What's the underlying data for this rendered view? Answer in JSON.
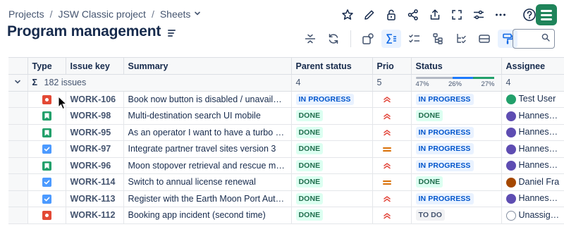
{
  "breadcrumb": {
    "projects": "Projects",
    "project": "JSW Classic project",
    "sheets": "Sheets"
  },
  "page": {
    "title": "Program management"
  },
  "table": {
    "columns": {
      "type": "Type",
      "key": "Issue key",
      "summary": "Summary",
      "parent_status": "Parent status",
      "prio": "Prio",
      "status": "Status",
      "assignee": "Assignee"
    },
    "summary_row": {
      "sigma": "Σ",
      "issues": "182 issues",
      "parent_status": "4",
      "prio": "5",
      "assignee": "4",
      "status_progress": {
        "todo": {
          "percent": 47,
          "label": "47%"
        },
        "in_progress": {
          "percent": 26,
          "label": "26%"
        },
        "done": {
          "percent": 27,
          "label": "27%"
        }
      }
    },
    "rows": [
      {
        "type": "bug",
        "key": "WORK-106",
        "summary": "Book now button is disabled / unavailable",
        "parent_status": "IN PROGRESS",
        "priority": "high",
        "status": "IN PROGRESS",
        "assignee": "Test User"
      },
      {
        "type": "story",
        "key": "WORK-98",
        "summary": "Multi-destination search UI mobile",
        "parent_status": "DONE",
        "priority": "high",
        "status": "DONE",
        "assignee": "Hannes Ob"
      },
      {
        "type": "story",
        "key": "WORK-95",
        "summary": "As an operator I want to have a turbo butt...",
        "parent_status": "DONE",
        "priority": "high",
        "status": "IN PROGRESS",
        "assignee": "Hannes Ob"
      },
      {
        "type": "task",
        "key": "WORK-97",
        "summary": "Integrate partner travel sites version 3",
        "parent_status": "DONE",
        "priority": "medium",
        "status": "IN PROGRESS",
        "assignee": "Hannes Ob"
      },
      {
        "type": "story",
        "key": "WORK-96",
        "summary": "Moon stopover retrieval and rescue missi...",
        "parent_status": "DONE",
        "priority": "high",
        "status": "IN PROGRESS",
        "assignee": "Hannes Ob"
      },
      {
        "type": "task",
        "key": "WORK-114",
        "summary": "Switch to annual license renewal",
        "parent_status": "DONE",
        "priority": "medium",
        "status": "DONE",
        "assignee": "Daniel Fra"
      },
      {
        "type": "task",
        "key": "WORK-113",
        "summary": "Register with the Earth Moon Port Authority",
        "parent_status": "DONE",
        "priority": "high",
        "status": "IN PROGRESS",
        "assignee": "Hannes Ob"
      },
      {
        "type": "bug",
        "key": "WORK-112",
        "summary": "Booking app incident (second time)",
        "parent_status": "DONE",
        "priority": "high",
        "status": "TO DO",
        "assignee": "Unassigne"
      }
    ]
  },
  "colors": {
    "progress_blue": "#0055cc",
    "done_green": "#216e4e",
    "bug_red": "#e34935",
    "story_green": "#22a06b",
    "task_blue": "#4c9aff",
    "priority_high": "#e2483d",
    "priority_medium": "#d97008"
  },
  "icons": {
    "top_actions": [
      "star-icon",
      "edit-icon",
      "lock-icon",
      "share-icon",
      "export-icon",
      "fullscreen-icon",
      "settings-sliders-icon",
      "more-icon",
      "help-icon"
    ],
    "toolbar": [
      "collapse-rows-icon",
      "refresh-icon",
      "view-icon",
      "sum-icon",
      "checklist-icon",
      "hierarchy-icon",
      "hierarchy-check-icon",
      "card-icon",
      "paint-format-icon",
      "search-icon"
    ]
  }
}
